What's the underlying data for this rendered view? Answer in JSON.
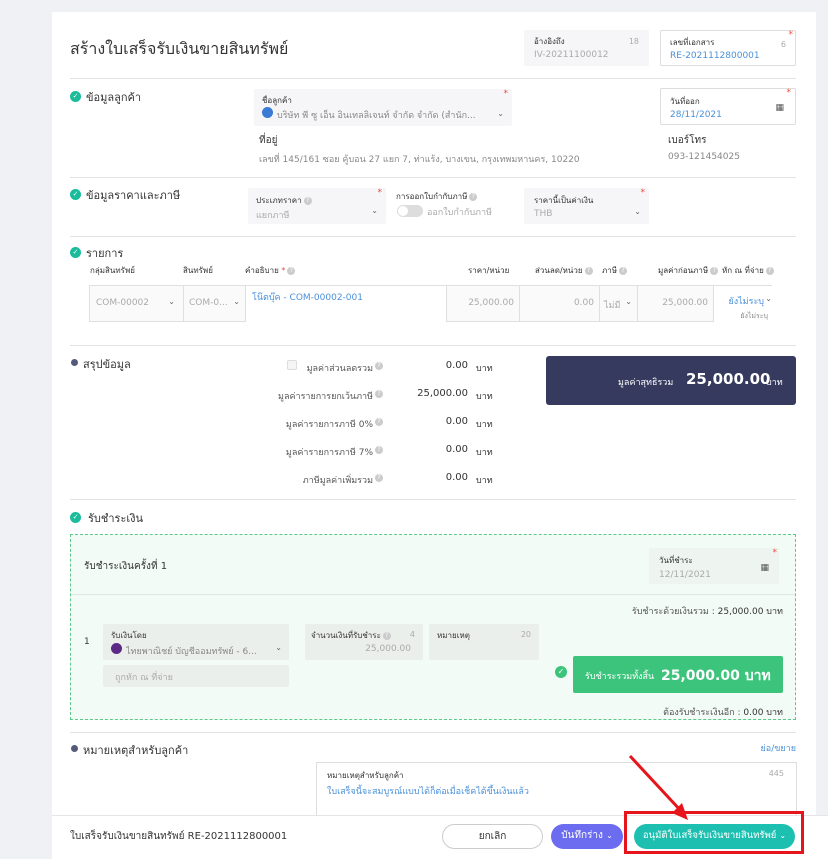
{
  "header": {
    "title": "สร้างใบเสร็จรับเงินขายสินทรัพย์",
    "ref_label": "อ้างอิงถึง",
    "ref_count": "18",
    "ref_value": "IV-20211100012",
    "doc_label": "เลขที่เอกสาร",
    "doc_count": "6",
    "doc_value": "RE-2021112800001"
  },
  "customer": {
    "section_title": "ข้อมูลลูกค้า",
    "name_label": "ชื่อลูกค้า",
    "name_value": "บริษัท พี ซู เอ็น อินเทลลิเจนท์ จำกัด จำกัด (สำนัก...",
    "issue_date_label": "วันที่ออก",
    "issue_date_value": "28/11/2021",
    "address_label": "ที่อยู่",
    "address_value": "เลขที่ 145/161 ซอย คู้บอน 27 แยก 7, ท่าแร้ง, บางเขน, กรุงเทพมหานคร, 10220",
    "phone_label": "เบอร์โทร",
    "phone_value": "093-121454025"
  },
  "pricing": {
    "section_title": "ข้อมูลราคาและภาษี",
    "price_type_label": "ประเภทราคา",
    "price_type_value": "แยกภาษี",
    "tax_invoice_label": "การออกใบกำกับภาษี",
    "tax_invoice_toggle": "ออกใบกำกับภาษี",
    "currency_label": "ราคานี้เป็นค่าเงิน",
    "currency_value": "THB"
  },
  "items": {
    "section_title": "รายการ",
    "columns": {
      "group": "กลุ่มสินทรัพย์",
      "asset": "สินทรัพย์",
      "desc": "คำอธิบาย",
      "price": "ราคา/หน่วย",
      "discount": "ส่วนลด/หน่วย",
      "tax": "ภาษี",
      "pretax": "มูลค่าก่อนภาษี",
      "wht": "หัก ณ ที่จ่าย"
    },
    "row": {
      "group": "COM-00002",
      "asset": "COM-0...",
      "desc": "โน๊ตบุ๊ค - COM-00002-001",
      "price": "25,000.00",
      "discount": "0.00",
      "tax": "ไม่มี",
      "pretax": "25,000.00",
      "wht": "ยังไม่ระบุ",
      "wht_sub": "ยังไม่ระบุ"
    }
  },
  "summary": {
    "section_title": "สรุปข้อมูล",
    "lines": [
      {
        "label": "มูลค่าส่วนลดรวม",
        "value": "0.00",
        "unit": "บาท"
      },
      {
        "label": "มูลค่ารายการยกเว้นภาษี",
        "value": "25,000.00",
        "unit": "บาท"
      },
      {
        "label": "มูลค่ารายการภาษี 0%",
        "value": "0.00",
        "unit": "บาท"
      },
      {
        "label": "มูลค่ารายการภาษี 7%",
        "value": "0.00",
        "unit": "บาท"
      },
      {
        "label": "ภาษีมูลค่าเพิ่มรวม",
        "value": "0.00",
        "unit": "บาท"
      }
    ],
    "net_label": "มูลค่าสุทธิรวม",
    "net_value": "25,000.00",
    "net_unit": "บาท"
  },
  "payment": {
    "section_title": "รับชำระเงิน",
    "round_title": "รับชำระเงินครั้งที่ 1",
    "pay_date_label": "วันที่ชำระ",
    "pay_date_value": "12/11/2021",
    "total_label": "รับชำระด้วยเงินรวม :",
    "total_value": "25,000.00 บาท",
    "row_no": "1",
    "method_label": "รับเงินโดย",
    "method_value": "ไทยพาณิชย์ บัญชีออมทรัพย์ - 6...",
    "amount_label": "จำนวนเงินที่รับชำระ",
    "amount_count": "4",
    "amount_value": "25,000.00",
    "note_label": "หมายเหตุ",
    "note_count": "20",
    "wht_placeholder": "ถูกหัก ณ ที่จ่าย",
    "grand_label": "รับชำระรวมทั้งสิ้น",
    "grand_value": "25,000.00 บาท",
    "remaining_label": "ต้องรับชำระเงินอีก :",
    "remaining_value": "0.00 บาท"
  },
  "remark": {
    "section_title": "หมายเหตุสำหรับลูกค้า",
    "toggle_link": "ย่อ/ขยาย",
    "box_label": "หมายเหตุสำหรับลูกค้า",
    "box_count": "445",
    "box_value": "ใบเสร็จนี้จะสมบูรณ์แบบได้ก็ต่อเมื่อเช็คได้ขึ้นเงินแล้ว"
  },
  "footer": {
    "doc_title": "ใบเสร็จรับเงินขายสินทรัพย์ RE-2021112800001",
    "cancel_label": "ยกเลิก",
    "draft_label": "บันทึกร่าง",
    "approve_label": "อนุมัติใบเสร็จรับเงินขายสินทรัพย์"
  },
  "colors": {
    "primary": "#6c6cf0",
    "teal": "#1dc0b0",
    "green": "#3cc47c",
    "navy": "#363a5e",
    "highlight": "#e6141b"
  }
}
